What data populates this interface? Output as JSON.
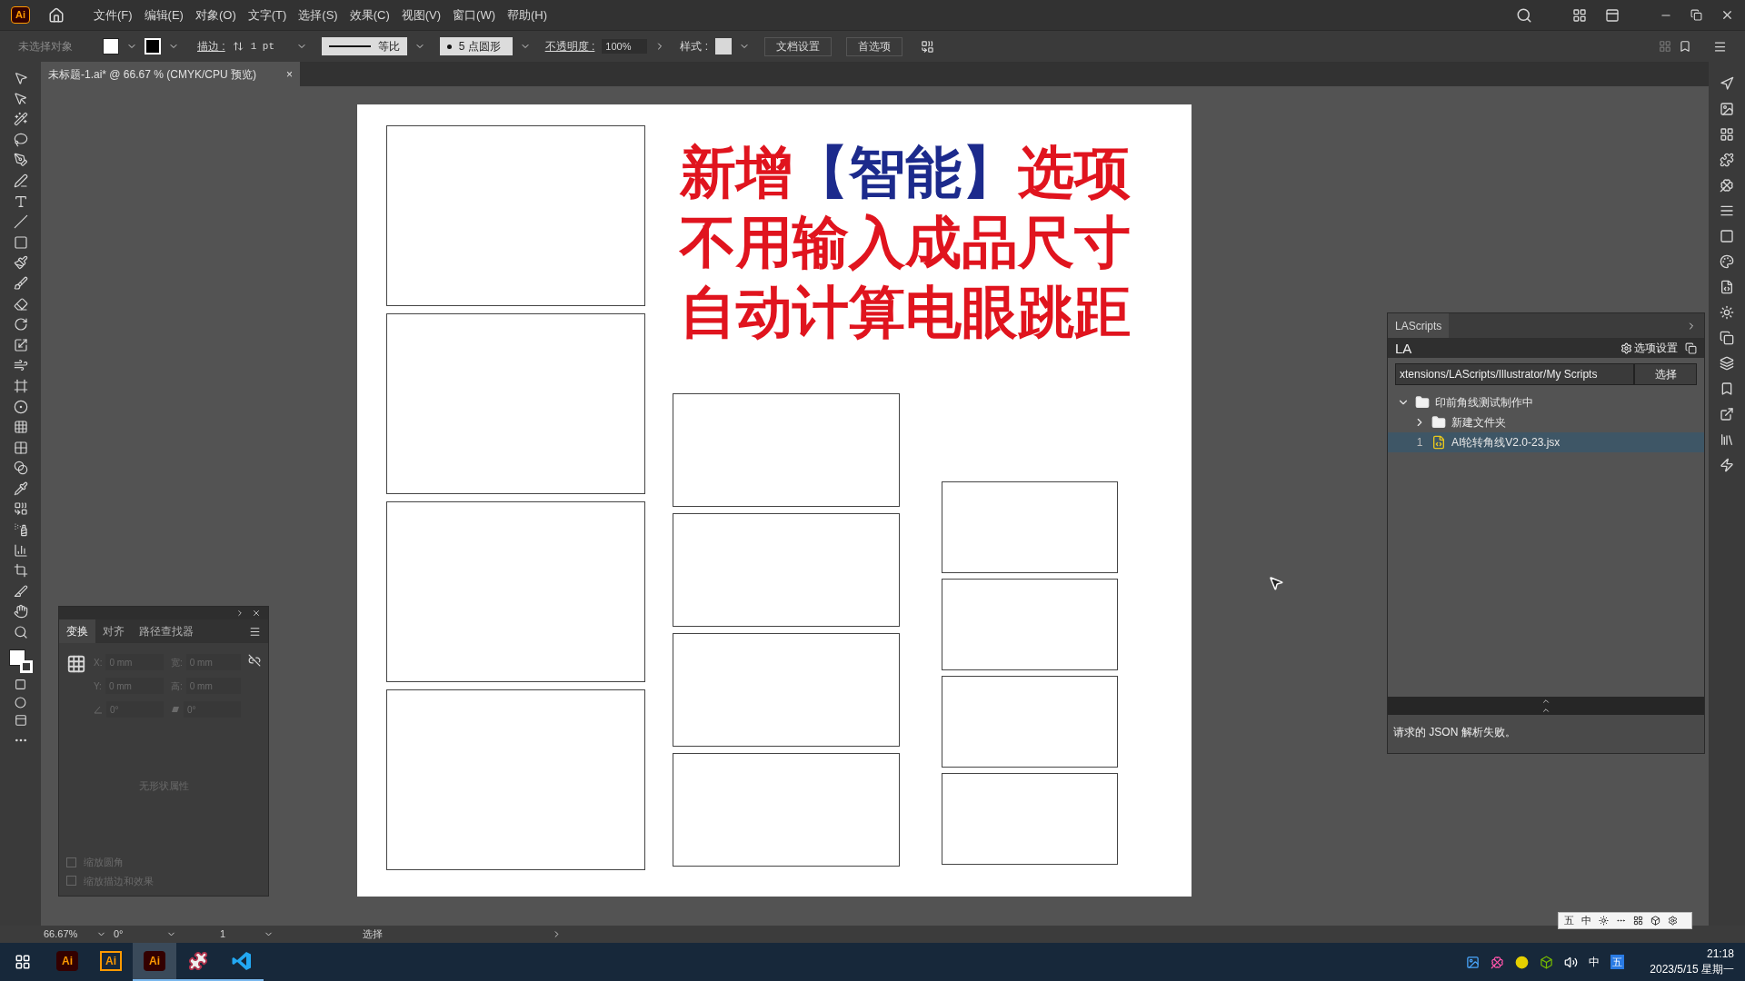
{
  "app_logo": "Ai",
  "menu": [
    "文件(F)",
    "编辑(E)",
    "对象(O)",
    "文字(T)",
    "选择(S)",
    "效果(C)",
    "视图(V)",
    "窗口(W)",
    "帮助(H)"
  ],
  "control_bar": {
    "selection": "未选择对象",
    "stroke_label": "描边 :",
    "stroke_weight": "1 pt",
    "stroke_profile": "等比",
    "brush": "5 点圆形",
    "opacity_label": "不透明度 :",
    "opacity": "100%",
    "style_label": "样式 :",
    "buttons": [
      "文档设置",
      "首选项"
    ]
  },
  "document_tab": {
    "title": "未标题-1.ai* @ 66.67 % (CMYK/CPU 预览)",
    "close": "×"
  },
  "artboard": {
    "headline": [
      [
        {
          "text": "新增",
          "color": "#e0141e"
        },
        {
          "text": "【智能】",
          "color": "#1c2a8c"
        },
        {
          "text": "选项",
          "color": "#e0141e"
        }
      ],
      [
        {
          "text": "不用输入成品尺寸",
          "color": "#e0141e"
        }
      ],
      [
        {
          "text": "自动计算电眼跳距",
          "color": "#e0141e"
        }
      ]
    ]
  },
  "transform_panel": {
    "disabled": true,
    "tabs": [
      {
        "label": "变换",
        "selected": true
      },
      {
        "label": "对齐",
        "selected": false
      },
      {
        "label": "路径查找器",
        "selected": false
      }
    ],
    "fields": [
      {
        "label": "X:",
        "value": "0 mm"
      },
      {
        "label": "宽:",
        "value": "0 mm"
      },
      {
        "label": "Y:",
        "value": "0 mm"
      },
      {
        "label": "高:",
        "value": "0 mm"
      }
    ],
    "angle": "0°",
    "shear": "0°",
    "empty_message": "无形状属性",
    "options": [
      {
        "label": "缩放圆角",
        "checked": false
      },
      {
        "label": "缩放描边和效果",
        "checked": false
      }
    ]
  },
  "lascripts_panel": {
    "title": "LAScripts",
    "logo": "LA",
    "settings": "选项设置",
    "path": "xtensions/LAScripts/Illustrator/My Scripts",
    "choose_button": "选择",
    "tree": [
      {
        "label": "印前角线测试制作中",
        "kind": "folder",
        "expanded": true,
        "selected": false,
        "children": [
          {
            "label": "新建文件夹",
            "kind": "folder",
            "expanded": false,
            "selected": false
          },
          {
            "label": "AI轮转角线V2.0-23.jsx",
            "kind": "script",
            "number": "1",
            "selected": true
          }
        ]
      }
    ],
    "message": "请求的 JSON 解析失败。"
  },
  "ime_bar": [
    "五",
    "中"
  ],
  "status_bar": {
    "zoom": "66.67%",
    "rotation": "0°",
    "artboard": "1",
    "tool": "选择"
  },
  "taskbar": {
    "apps": [
      {
        "kind": "ai-dark",
        "label": "Ai",
        "running": false,
        "selected": false
      },
      {
        "kind": "ai-outline",
        "label": "Ai",
        "running": false,
        "selected": false
      },
      {
        "kind": "ai-dark",
        "label": "Ai",
        "running": true,
        "selected": true
      },
      {
        "kind": "app",
        "running": true,
        "selected": false
      },
      {
        "kind": "vscode",
        "running": true,
        "selected": false
      }
    ],
    "ime": "中",
    "ime_icon": "五",
    "time": "21:18",
    "date": "2023/5/15 星期一"
  }
}
